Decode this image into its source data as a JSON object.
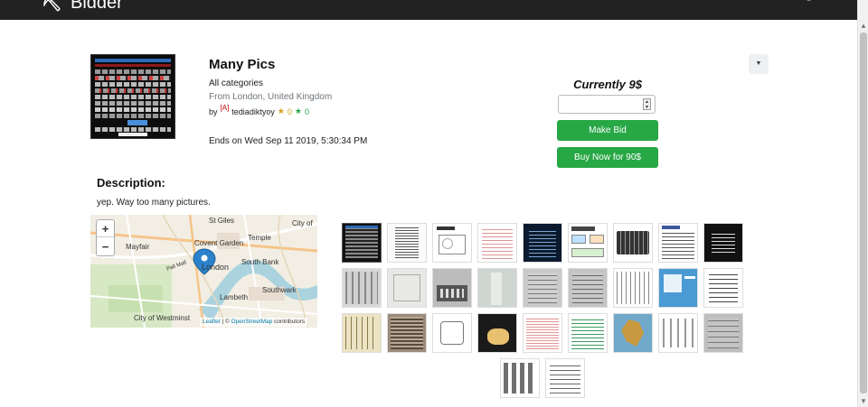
{
  "navbar": {
    "brand_icon": "logo-icon",
    "brand": "Bidder",
    "right_icon": "user-icon"
  },
  "item": {
    "title": "Many Pics",
    "category": "All categories",
    "location": "From London, United Kingdom",
    "by_prefix": "by",
    "admin_tag": "[A]",
    "seller": "tediadiktyoy",
    "rating_negative": "0",
    "rating_positive": "0",
    "ends": "Ends on Wed Sep 11 2019, 5:30:34 PM"
  },
  "bidding": {
    "current": "Currently 9$",
    "input_value": "",
    "make_bid_label": "Make Bid",
    "buy_now_label": "Buy Now for 90$"
  },
  "description": {
    "heading": "Description:",
    "text": "yep. Way too many pictures."
  },
  "map": {
    "labels": [
      "St Giles",
      "City of",
      "Temple",
      "Mayfair",
      "Covent Garden",
      "South Bank",
      "London",
      "Southwark",
      "Lambeth",
      "City of Westminst",
      "Pall Mall"
    ],
    "zoom_in": "+",
    "zoom_out": "−",
    "attrib_leaflet": "Leaflet",
    "attrib_sep": " | © ",
    "attrib_osm": "OpenStreetMap",
    "attrib_tail": " contributors"
  },
  "colors": {
    "accent_green": "#28a745",
    "navbar": "#222222"
  }
}
